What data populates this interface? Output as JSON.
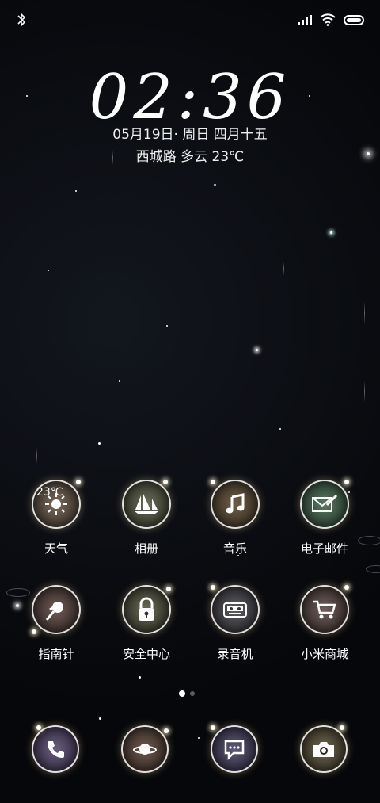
{
  "status_bar": {
    "left_icon": "bluetooth-icon",
    "right_icons": [
      "signal-icon",
      "wifi-icon",
      "battery-icon"
    ]
  },
  "lock": {
    "time": "02:36",
    "date": "05月19日· 周日 四月十五",
    "weather": "西城路  多云  23℃"
  },
  "apps_row1": [
    {
      "label": "天气",
      "icon": "weather-sun-icon",
      "badge": "23℃"
    },
    {
      "label": "相册",
      "icon": "sailboats-icon"
    },
    {
      "label": "音乐",
      "icon": "music-note-icon"
    },
    {
      "label": "电子邮件",
      "icon": "envelope-icon"
    }
  ],
  "apps_row2": [
    {
      "label": "指南针",
      "icon": "compass-pin-icon"
    },
    {
      "label": "安全中心",
      "icon": "lock-icon"
    },
    {
      "label": "录音机",
      "icon": "recorder-icon"
    },
    {
      "label": "小米商城",
      "icon": "cart-icon"
    }
  ],
  "dock": [
    {
      "icon": "phone-icon"
    },
    {
      "icon": "planet-icon"
    },
    {
      "icon": "chat-bubble-icon"
    },
    {
      "icon": "camera-icon"
    }
  ],
  "page_indicator": {
    "current": 1,
    "total": 2
  }
}
